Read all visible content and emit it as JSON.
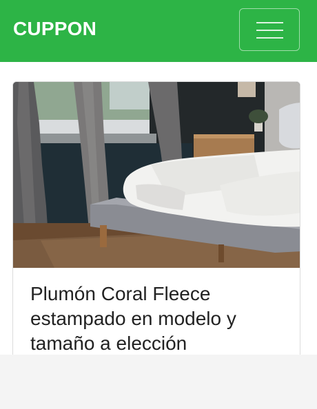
{
  "navbar": {
    "brand": "CUPPON",
    "menu_icon": "hamburger-menu-icon",
    "background_color": "#2db446"
  },
  "card": {
    "image_description": "bedroom-bed-photo",
    "title": "Plumón Coral Fleece estampado en modelo y tamaño a elección"
  }
}
